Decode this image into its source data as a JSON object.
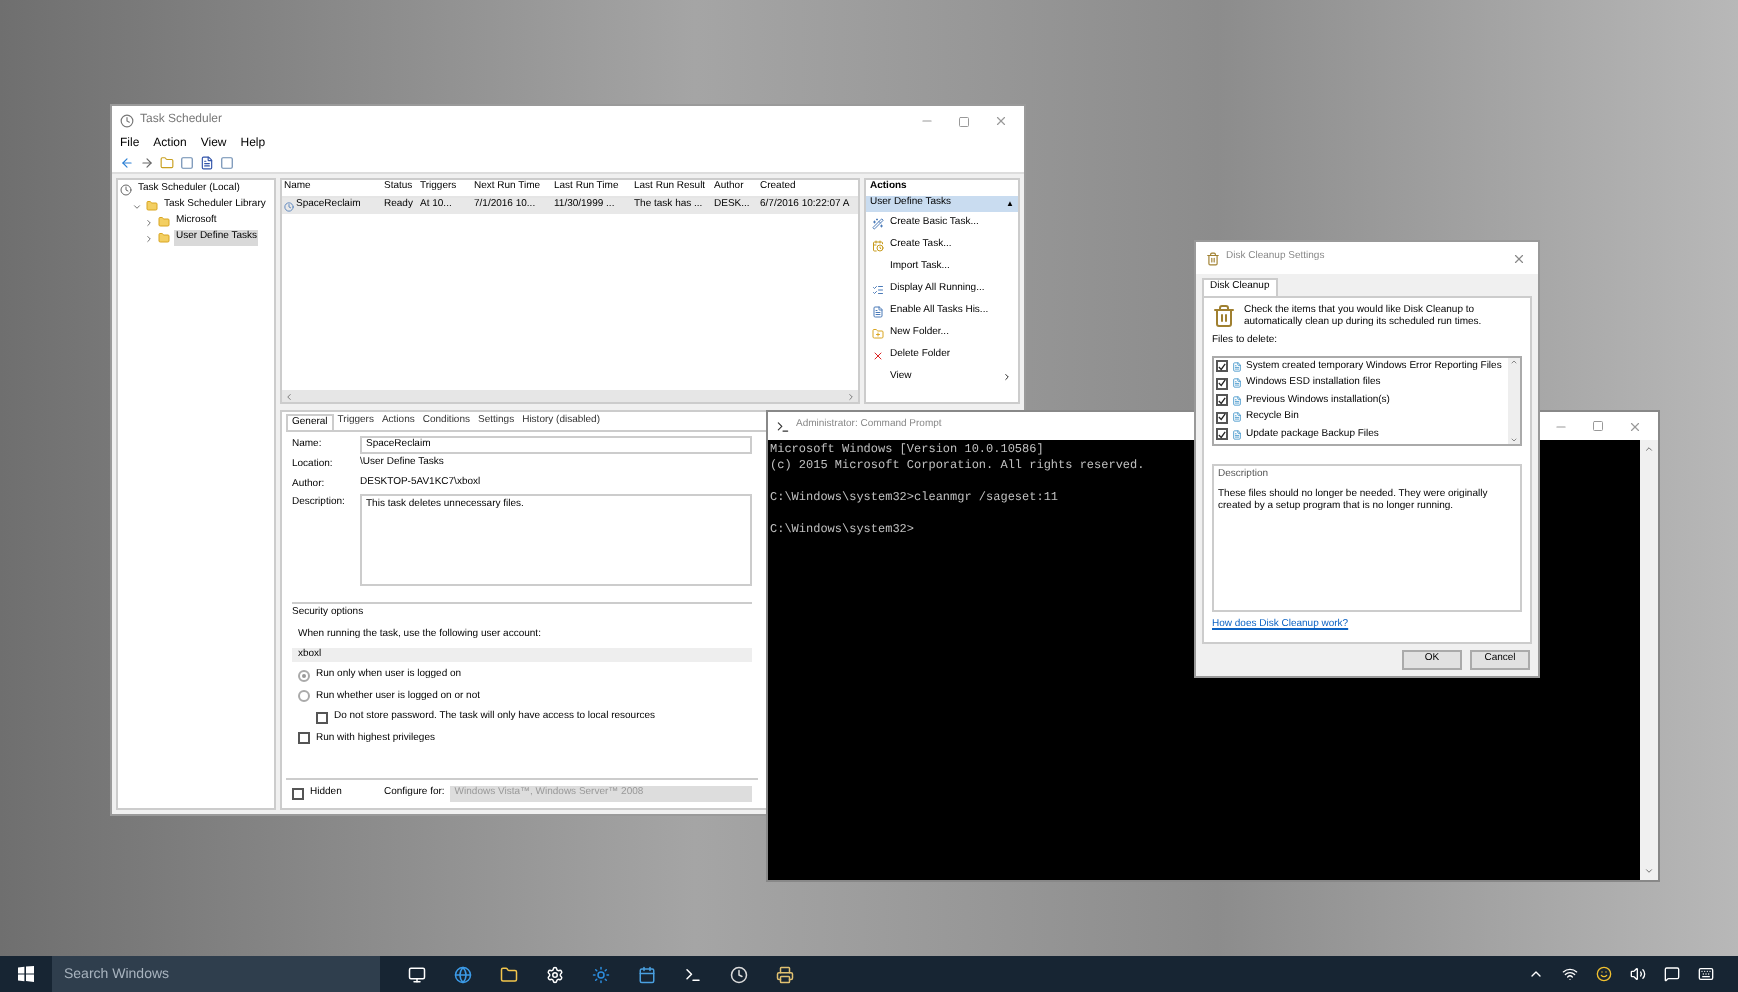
{
  "task_scheduler": {
    "title": "Task Scheduler",
    "menu": [
      "File",
      "Action",
      "View",
      "Help"
    ],
    "tree": [
      {
        "label": "Task Scheduler (Local)",
        "selected": false,
        "children": [
          {
            "label": "Task Scheduler Library",
            "selected": false,
            "expanded": true,
            "children": [
              {
                "label": "Microsoft",
                "selected": false,
                "expanded": false
              },
              {
                "label": "User Define Tasks",
                "selected": true,
                "expanded": false
              }
            ]
          }
        ]
      }
    ],
    "table": {
      "columns": [
        "Name",
        "Status",
        "Triggers",
        "Next Run Time",
        "Last Run Time",
        "Last Run Result",
        "Author",
        "Created"
      ],
      "rows": [
        {
          "cells": [
            "SpaceReclaim",
            "Ready",
            "At 10...",
            "7/1/2016 10...",
            "11/30/1999 ...",
            "The task has ...",
            "DESK...",
            "6/7/2016 10:22:07 A"
          ],
          "selected": true
        }
      ]
    },
    "actions": {
      "header": "Actions",
      "section": "User Define Tasks",
      "section_arrow": "▲",
      "items": [
        {
          "label": "Create Basic Task...",
          "kind": "wizard"
        },
        {
          "label": "Create Task...",
          "kind": "task"
        },
        {
          "label": "Import Task...",
          "kind": "none"
        },
        {
          "label": "Display All Running...",
          "kind": "list"
        },
        {
          "label": "Enable All Tasks His...",
          "kind": "log"
        },
        {
          "label": "New Folder...",
          "kind": "folder"
        },
        {
          "label": "Delete Folder",
          "kind": "delete"
        },
        {
          "label": "View",
          "kind": "submenu"
        }
      ]
    },
    "details": {
      "tabs": [
        {
          "label": "General",
          "selected": true
        },
        {
          "label": "Triggers",
          "selected": false
        },
        {
          "label": "Actions",
          "selected": false
        },
        {
          "label": "Conditions",
          "selected": false
        },
        {
          "label": "Settings",
          "selected": false
        },
        {
          "label": "History (disabled)",
          "selected": false
        }
      ],
      "fields": [
        {
          "label": "Name:",
          "value": "SpaceReclaim",
          "kind": "input"
        },
        {
          "label": "Location:",
          "value": "\\User Define Tasks",
          "kind": "text"
        },
        {
          "label": "Author:",
          "value": "DESKTOP-5AV1KC7\\xboxl",
          "kind": "text"
        },
        {
          "label": "Description:",
          "value": "This task deletes unnecessary files.",
          "kind": "area"
        }
      ],
      "security": {
        "title": "Security options",
        "prompt": "When running the task, use the following user account:",
        "account": "xboxl",
        "options": [
          {
            "kind": "radio",
            "label": "Run only when user is logged on",
            "selected": true
          },
          {
            "kind": "radio",
            "label": "Run whether user is logged on or not",
            "selected": false,
            "children": [
              {
                "kind": "checkbox",
                "label": "Do not store password.  The task will only have access to local resources",
                "checked": false
              }
            ]
          },
          {
            "kind": "checkbox",
            "label": "Run with highest privileges",
            "checked": false
          }
        ]
      },
      "hidden": {
        "label": "Hidden",
        "checked": false
      },
      "configure": {
        "label": "Configure for:",
        "value": "Windows Vista™, Windows Server™ 2008"
      }
    }
  },
  "cmd": {
    "title": "Administrator: Command Prompt",
    "blocks": [
      [
        "Microsoft Windows [Version 10.0.10586]",
        "(c) 2015 Microsoft Corporation. All rights reserved."
      ],
      [
        "C:\\Windows\\system32>cleanmgr /sageset:11"
      ],
      [
        "C:\\Windows\\system32>"
      ]
    ]
  },
  "disk_cleanup": {
    "title": "Disk Cleanup Settings",
    "tab": "Disk Cleanup",
    "intro": "Check the items that you would like Disk Cleanup to automatically clean up during its scheduled run times.",
    "files_label": "Files to delete:",
    "files": [
      {
        "label": "System created temporary Windows Error Reporting Files",
        "checked": true
      },
      {
        "label": "Windows ESD installation files",
        "checked": true
      },
      {
        "label": "Previous Windows installation(s)",
        "checked": true
      },
      {
        "label": "Recycle Bin",
        "checked": true
      },
      {
        "label": "Update package Backup Files",
        "checked": true
      }
    ],
    "description_label": "Description",
    "description": "These files should no longer be needed. They were originally created by a setup program that is no longer running.",
    "link": "How does Disk Cleanup work?",
    "buttons": [
      "OK",
      "Cancel"
    ]
  },
  "taskbar": {
    "search_placeholder": "Search Windows"
  }
}
